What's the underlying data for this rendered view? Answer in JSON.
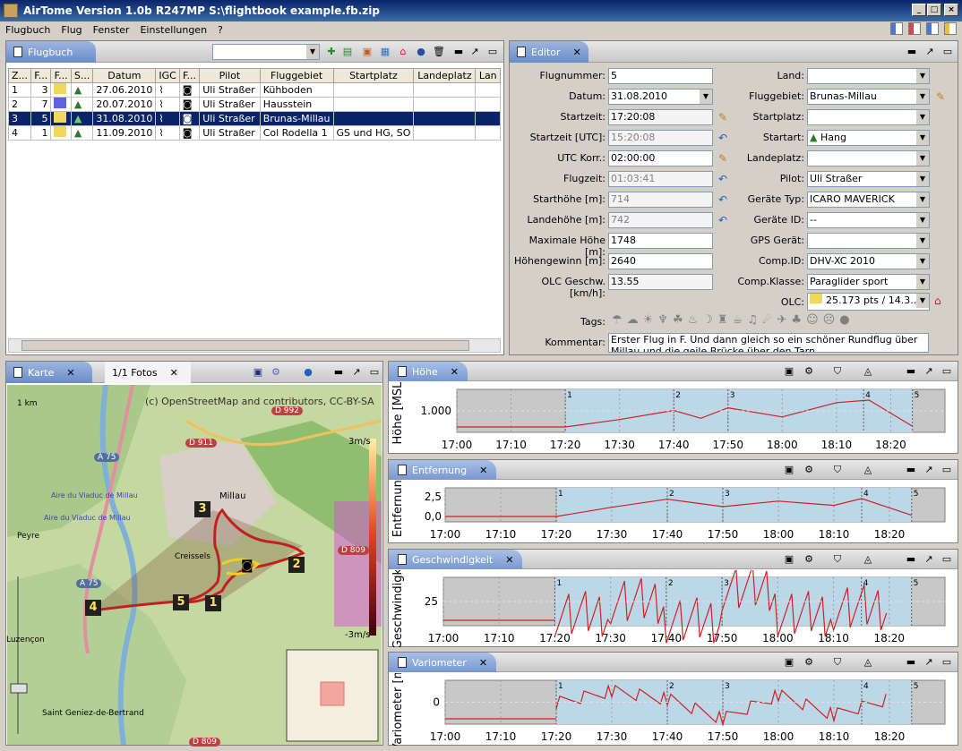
{
  "app": {
    "title": "AirTome Version 1.0b R247MP   S:\\flightbook example.fb.zip"
  },
  "menu": [
    "Flugbuch",
    "Flug",
    "Fenster",
    "Einstellungen",
    "?"
  ],
  "flugbuch": {
    "tab": "Flugbuch",
    "columns": [
      "Z...",
      "F...",
      "F...",
      "S...",
      "Datum",
      "IGC",
      "F...",
      "Pilot",
      "Fluggebiet",
      "Startplatz",
      "Landeplatz",
      "Lan"
    ],
    "rows": [
      {
        "z": "1",
        "f": "3",
        "datum": "27.06.2010",
        "pilot": "Uli Straßer",
        "gebiet": "Kühboden",
        "start": ""
      },
      {
        "z": "2",
        "f": "7",
        "datum": "20.07.2010",
        "pilot": "Uli Straßer",
        "gebiet": "Hausstein",
        "start": ""
      },
      {
        "z": "3",
        "f": "5",
        "datum": "31.08.2010",
        "pilot": "Uli Straßer",
        "gebiet": "Brunas-Millau",
        "start": ""
      },
      {
        "z": "4",
        "f": "1",
        "datum": "11.09.2010",
        "pilot": "Uli Straßer",
        "gebiet": "Col Rodella  1",
        "start": "GS und HG, SO"
      }
    ]
  },
  "editor": {
    "tab": "Editor",
    "left": [
      {
        "label": "Flugnummer:",
        "value": "5"
      },
      {
        "label": "Datum:",
        "value": "31.08.2010"
      },
      {
        "label": "Startzeit:",
        "value": "17:20:08"
      },
      {
        "label": "Startzeit [UTC]:",
        "value": "15:20:08"
      },
      {
        "label": "UTC Korr.:",
        "value": "02:00:00"
      },
      {
        "label": "Flugzeit:",
        "value": "01:03:41"
      },
      {
        "label": "Starthöhe [m]:",
        "value": "714"
      },
      {
        "label": "Landehöhe [m]:",
        "value": "742"
      },
      {
        "label": "Maximale Höhe [m]:",
        "value": "1748"
      },
      {
        "label": "Höhengewinn [m]:",
        "value": "2640"
      },
      {
        "label": "OLC Geschw. [km/h]:",
        "value": "13.55"
      }
    ],
    "right": [
      {
        "label": "Land:",
        "value": ""
      },
      {
        "label": "Fluggebiet:",
        "value": "Brunas-Millau"
      },
      {
        "label": "Startplatz:",
        "value": ""
      },
      {
        "label": "Startart:",
        "value": "Hang"
      },
      {
        "label": "Landeplatz:",
        "value": ""
      },
      {
        "label": "Pilot:",
        "value": "Uli Straßer"
      },
      {
        "label": "Geräte Typ:",
        "value": "ICARO MAVERICK"
      },
      {
        "label": "Geräte ID:",
        "value": "--"
      },
      {
        "label": "GPS Gerät:",
        "value": ""
      },
      {
        "label": "Comp.ID:",
        "value": "DHV-XC 2010"
      },
      {
        "label": "Comp.Klasse:",
        "value": "Paraglider sport"
      },
      {
        "label": "OLC:",
        "value": "25.173 pts / 14.3..."
      }
    ],
    "tags_label": "Tags:",
    "kommentar_label": "Kommentar:",
    "kommentar": "Erster Flug in F. Und dann gleich so ein schöner Rundflug über Millau und die geile Brücke über den Tarn."
  },
  "karte": {
    "tab": "Karte",
    "tab2": "1/1 Fotos",
    "copyright": "(c) OpenStreetMap and contributors, CC-BY-SA",
    "scale": "1 km",
    "legend_top": "3m/s",
    "legend_bottom": "-3m/s",
    "places": [
      "Millau",
      "Creissels",
      "Peyre",
      "Luzençon",
      "Saint Geniez-de-Bertrand",
      "Aire du Viaduc de Millau",
      "Aire du Viaduc de Millau"
    ],
    "roads": [
      "A 75",
      "A 75",
      "D 911",
      "D 809",
      "D 809",
      "D 992"
    ],
    "markers": [
      "1",
      "2",
      "3",
      "4",
      "5"
    ]
  },
  "charts": [
    {
      "tab": "Höhe",
      "ylabel": "Höhe [MSL]",
      "ytick": "1.000",
      "markers": [
        "1",
        "2",
        "3",
        "4",
        "5"
      ]
    },
    {
      "tab": "Entfernung",
      "ylabel": "Entfernung",
      "yticks": [
        "2,5",
        "0,0"
      ],
      "markers": [
        "1",
        "2",
        "3",
        "4",
        "5"
      ]
    },
    {
      "tab": "Geschwindigkeit",
      "ylabel": "Geschwindigkeit",
      "ytick": "25",
      "markers": [
        "1",
        "2",
        "3",
        "4",
        "5"
      ]
    },
    {
      "tab": "Variometer",
      "ylabel": "Variometer [m/s]",
      "ytick": "0",
      "markers": [
        "1",
        "2",
        "3",
        "4",
        "5"
      ]
    }
  ],
  "xticks": [
    "17:00",
    "17:10",
    "17:20",
    "17:30",
    "17:40",
    "17:50",
    "18:00",
    "18:10",
    "18:20"
  ],
  "chart_data": [
    {
      "type": "line",
      "title": "Höhe",
      "ylabel": "Höhe [MSL]",
      "x": [
        "17:20",
        "17:30",
        "17:40",
        "17:45",
        "17:50",
        "18:00",
        "18:10",
        "18:16",
        "18:24"
      ],
      "values": [
        714,
        1000,
        1350,
        1050,
        1450,
        1100,
        1650,
        1748,
        742
      ]
    },
    {
      "type": "line",
      "title": "Entfernung",
      "ylabel": "Entfernung",
      "x": [
        "17:20",
        "17:30",
        "17:40",
        "17:50",
        "18:00",
        "18:10",
        "18:15",
        "18:24"
      ],
      "values": [
        0.0,
        1.5,
        2.8,
        1.6,
        2.5,
        1.8,
        2.9,
        0.2
      ]
    },
    {
      "type": "line",
      "title": "Geschwindigkeit",
      "ylabel": "Geschwindigkeit",
      "x": [
        "17:20",
        "17:30",
        "17:40",
        "17:50",
        "18:00",
        "18:10",
        "18:20"
      ],
      "values": [
        25,
        35,
        20,
        45,
        25,
        30,
        28
      ]
    },
    {
      "type": "line",
      "title": "Variometer",
      "ylabel": "Variometer [m/s]",
      "x": [
        "17:20",
        "17:30",
        "17:40",
        "17:50",
        "18:00",
        "18:10",
        "18:20"
      ],
      "values": [
        0,
        1.5,
        0.5,
        -2,
        1,
        -1.5,
        0.5
      ]
    }
  ]
}
